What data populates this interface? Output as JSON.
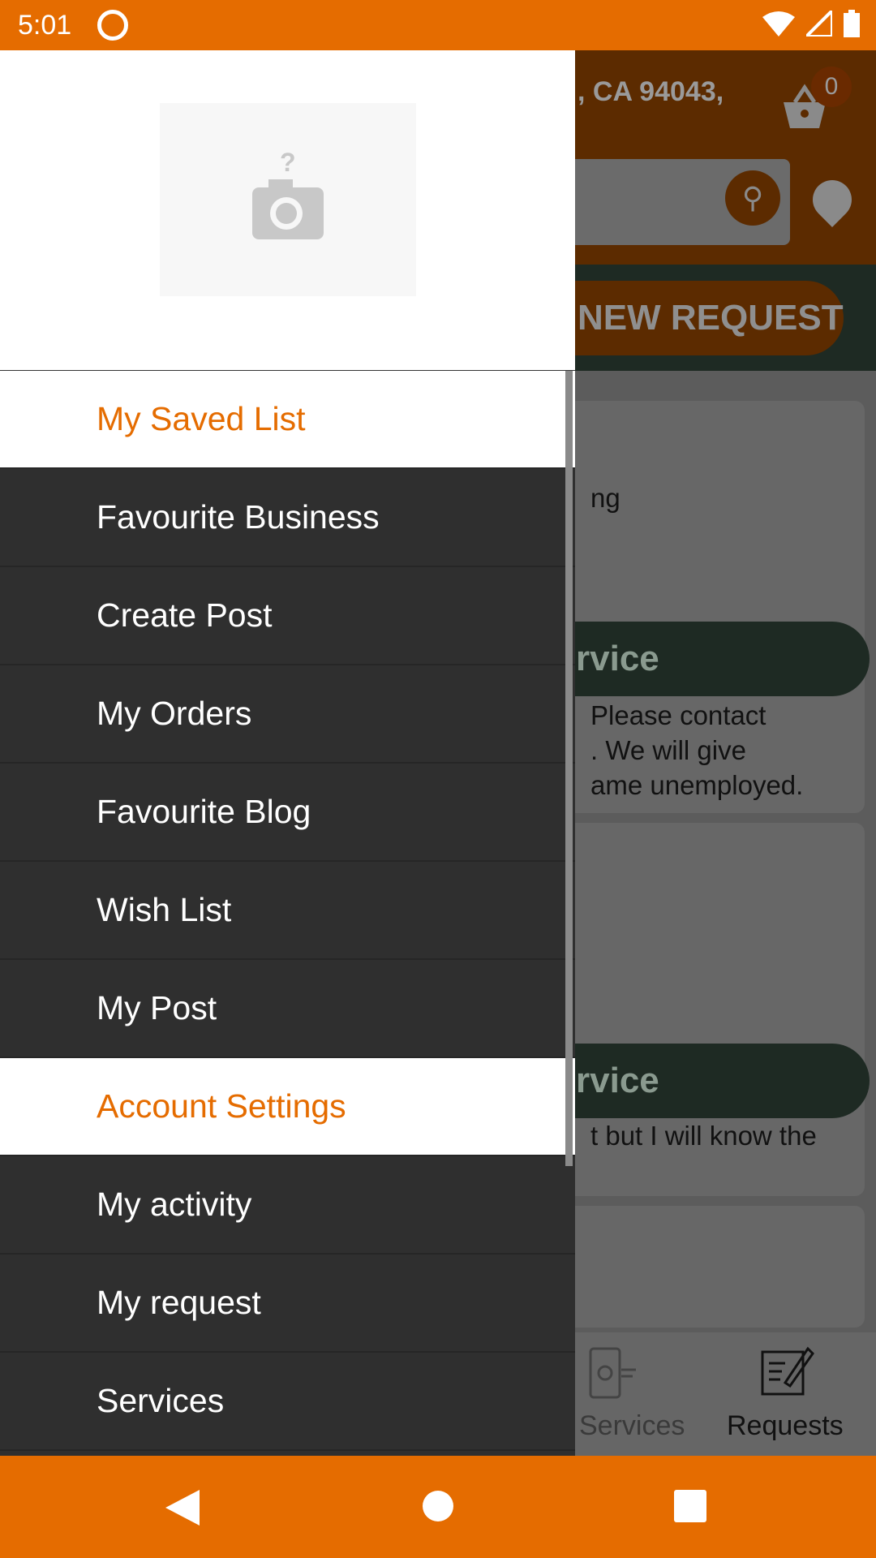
{
  "status": {
    "time": "5:01"
  },
  "app": {
    "address": ", CA 94043,",
    "cart_count": "0",
    "new_request": "NEW REQUEST",
    "cards": [
      {
        "line1": "ng",
        "pill": "rvice",
        "text": [
          "Please contact",
          ". We will give",
          "ame unemployed."
        ]
      },
      {
        "pill": "rvice",
        "text": [
          "t but I will know the"
        ]
      }
    ],
    "bottom_nav": [
      {
        "label": "Services",
        "icon": "services-icon"
      },
      {
        "label": "Requests",
        "icon": "requests-icon"
      }
    ]
  },
  "drawer": {
    "avatar_icon": "camera-placeholder-icon",
    "items": [
      {
        "label": "My Saved List",
        "section": true
      },
      {
        "label": "Favourite Business"
      },
      {
        "label": "Create Post"
      },
      {
        "label": "My Orders"
      },
      {
        "label": "Favourite Blog"
      },
      {
        "label": "Wish List"
      },
      {
        "label": "My Post"
      },
      {
        "label": "Account Settings",
        "section": true
      },
      {
        "label": "My activity"
      },
      {
        "label": "My request"
      },
      {
        "label": "Services"
      }
    ]
  },
  "colors": {
    "accent": "#e56c00",
    "drawer_bg": "#2f2f2f",
    "green": "#3a5244"
  }
}
